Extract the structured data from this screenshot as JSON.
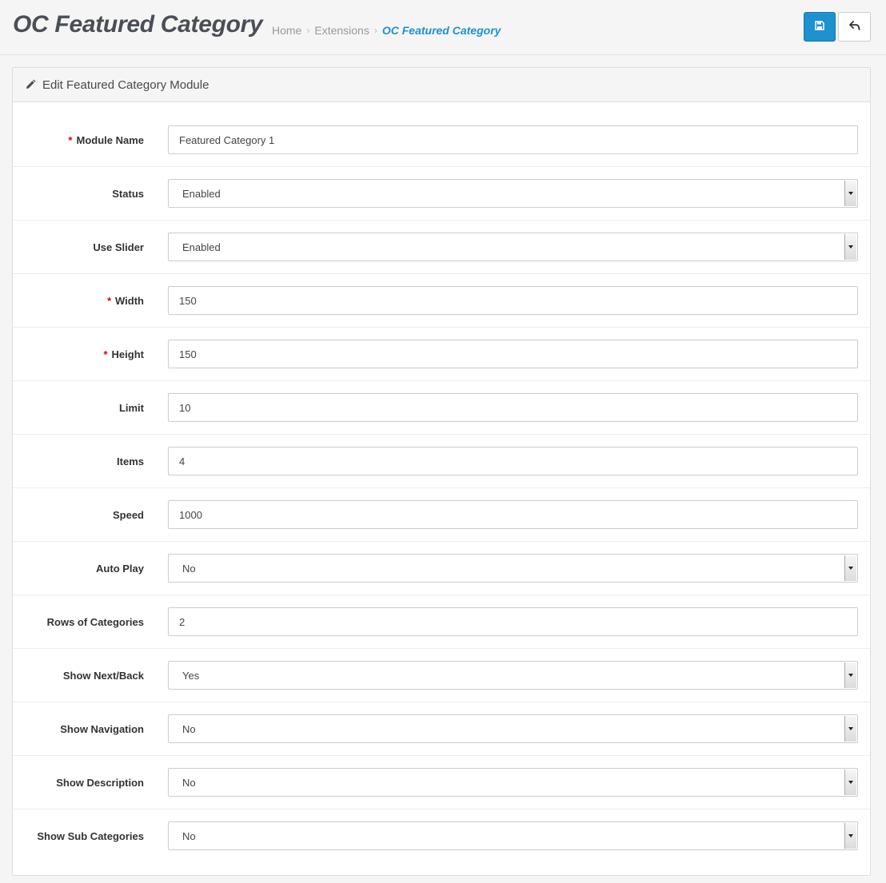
{
  "header": {
    "title": "OC Featured Category",
    "breadcrumbs": [
      "Home",
      "Extensions",
      "OC Featured Category"
    ]
  },
  "buttons": {
    "save_icon": "floppy-disk-icon",
    "back_icon": "reply-arrow-icon"
  },
  "panel": {
    "title": "Edit Featured Category Module",
    "icon": "pencil-icon"
  },
  "form": {
    "fields": [
      {
        "label": "Module Name",
        "required": true,
        "type": "text",
        "value": "Featured Category 1"
      },
      {
        "label": "Status",
        "required": false,
        "type": "select",
        "value": "Enabled"
      },
      {
        "label": "Use Slider",
        "required": false,
        "type": "select",
        "value": "Enabled"
      },
      {
        "label": "Width",
        "required": true,
        "type": "text",
        "value": "150"
      },
      {
        "label": "Height",
        "required": true,
        "type": "text",
        "value": "150"
      },
      {
        "label": "Limit",
        "required": false,
        "type": "text",
        "value": "10"
      },
      {
        "label": "Items",
        "required": false,
        "type": "text",
        "value": "4"
      },
      {
        "label": "Speed",
        "required": false,
        "type": "text",
        "value": "1000"
      },
      {
        "label": "Auto Play",
        "required": false,
        "type": "select",
        "value": "No"
      },
      {
        "label": "Rows of Categories",
        "required": false,
        "type": "text",
        "value": "2"
      },
      {
        "label": "Show Next/Back",
        "required": false,
        "type": "select",
        "value": "Yes"
      },
      {
        "label": "Show Navigation",
        "required": false,
        "type": "select",
        "value": "No"
      },
      {
        "label": "Show Description",
        "required": false,
        "type": "select",
        "value": "No"
      },
      {
        "label": "Show Sub Categories",
        "required": false,
        "type": "select",
        "value": "No"
      }
    ]
  },
  "colors": {
    "primary": "#1e91cf",
    "required": "#d9001b",
    "breadcrumb_active": "#1e91cf"
  }
}
